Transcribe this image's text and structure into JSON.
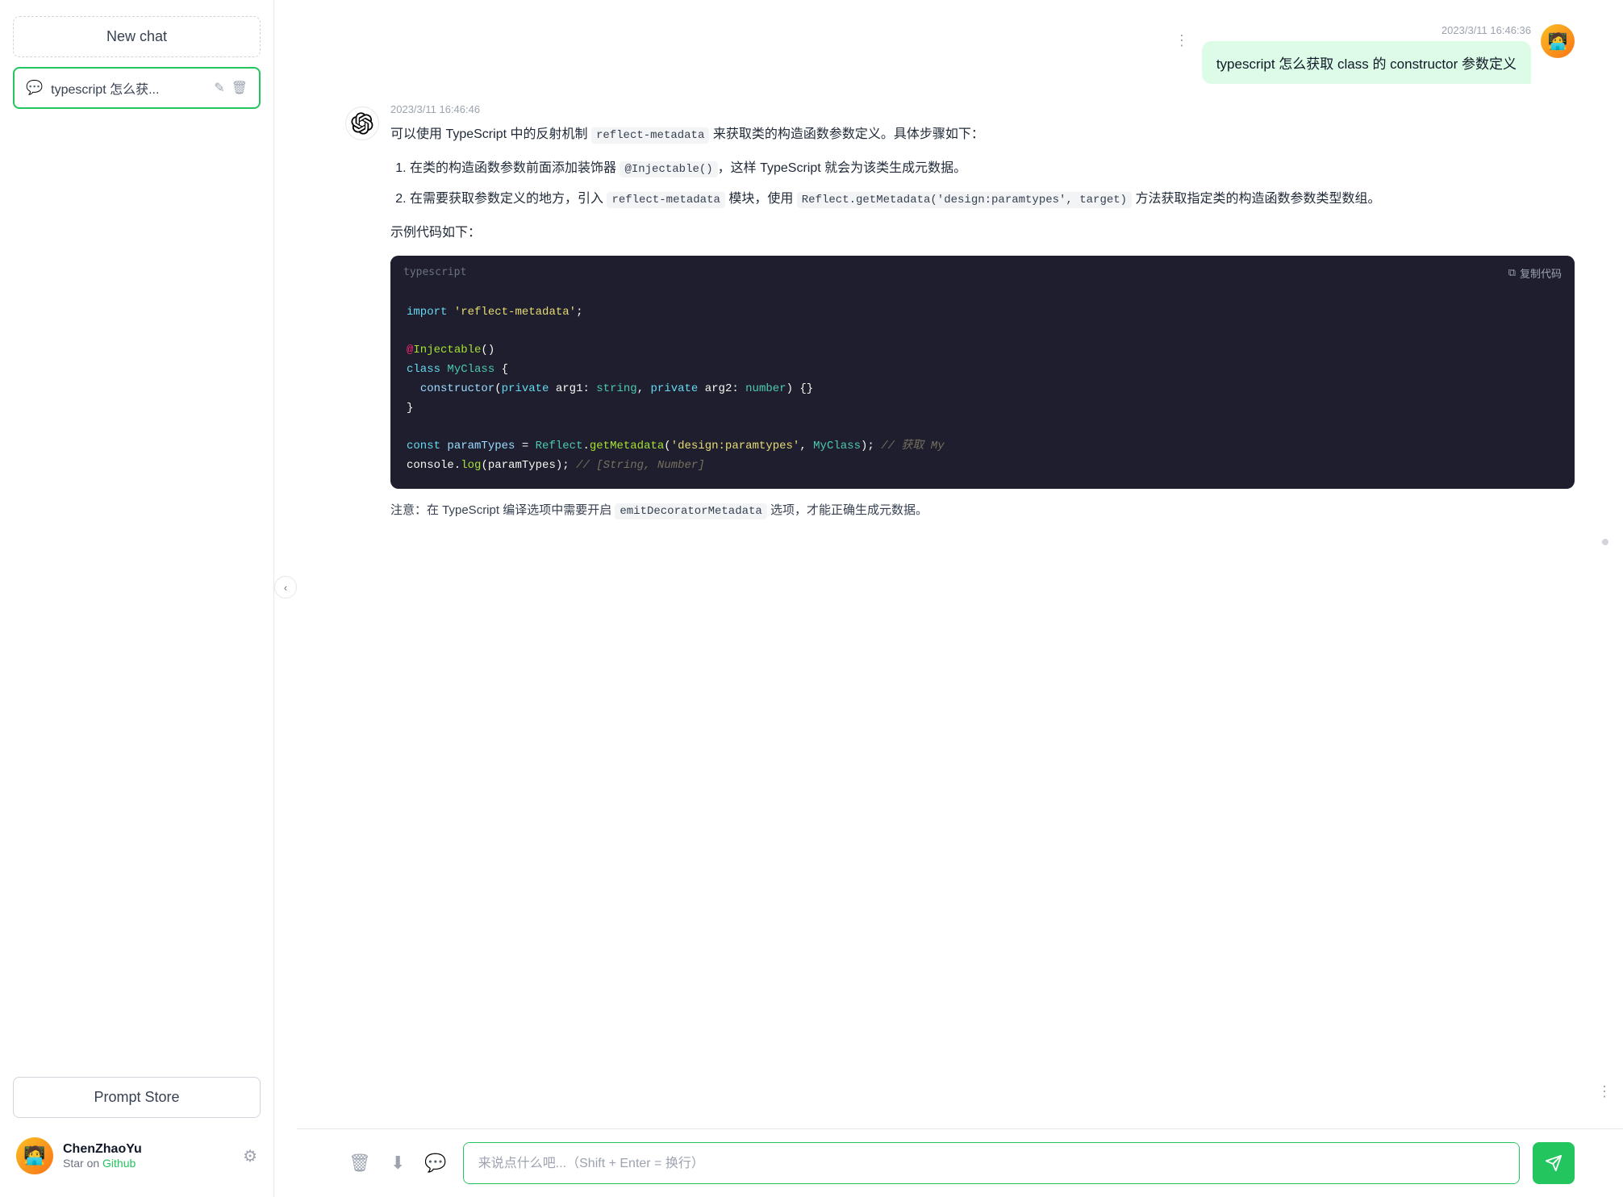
{
  "sidebar": {
    "new_chat_label": "New chat",
    "chat_item": {
      "icon": "💬",
      "title": "typescript 怎么获...",
      "edit_icon": "✎",
      "delete_icon": "🗑"
    },
    "prompt_store_label": "Prompt Store",
    "user": {
      "name": "ChenZhaoYu",
      "sub_text": "Star on",
      "link_text": "Github",
      "settings_icon": "⚙"
    }
  },
  "chat": {
    "user_timestamp": "2023/3/11 16:46:36",
    "user_message": "typescript 怎么获取 class 的 constructor 参数定义",
    "ai_timestamp": "2023/3/11 16:46:46",
    "ai_intro": "可以使用 TypeScript 中的反射机制",
    "ai_inline_code_1": "reflect-metadata",
    "ai_intro2": "来获取类的构造函数参数定义。具体步骤如下：",
    "ai_list": [
      {
        "text_before": "在类的构造函数参数前面添加装饰器",
        "code": "@Injectable()",
        "text_after": "，这样 TypeScript 就会为该类生成元数据。"
      },
      {
        "text_before": "在需要获取参数定义的地方，引入",
        "code": "reflect-metadata",
        "text_after": "模块，使用",
        "code2": "Reflect.getMetadata('design:paramtypes', target)",
        "text_after2": "方法获取指定类的构造函数参数类型数组。"
      }
    ],
    "example_label": "示例代码如下：",
    "code_lang": "typescript",
    "copy_label": "复制代码",
    "code_lines": [
      {
        "text": "import 'reflect-metadata';",
        "color": "yellow",
        "raw": true
      },
      {
        "text": "",
        "color": "white"
      },
      {
        "text": "@Injectable()",
        "color": "green_dec"
      },
      {
        "text": "class MyClass {",
        "color": "mixed_class"
      },
      {
        "text": "  constructor(private arg1: string, private arg2: number) {}",
        "color": "constructor_line"
      },
      {
        "text": "}",
        "color": "white"
      },
      {
        "text": "",
        "color": "white"
      },
      {
        "text": "const paramTypes = Reflect.getMetadata('design:paramtypes', MyClass); // 获取 My",
        "color": "const_line"
      },
      {
        "text": "console.log(paramTypes); // [String, Number]",
        "color": "console_line"
      }
    ],
    "note_before": "注意：在 TypeScript 编译选项中需要开启",
    "note_code": "emitDecoratorMetadata",
    "note_after": "选项，才能正确生成元数据。"
  },
  "input": {
    "placeholder": "来说点什么吧...（Shift + Enter = 换行）"
  },
  "colors": {
    "accent": "#22c55e",
    "user_bubble": "#dcfce7"
  }
}
